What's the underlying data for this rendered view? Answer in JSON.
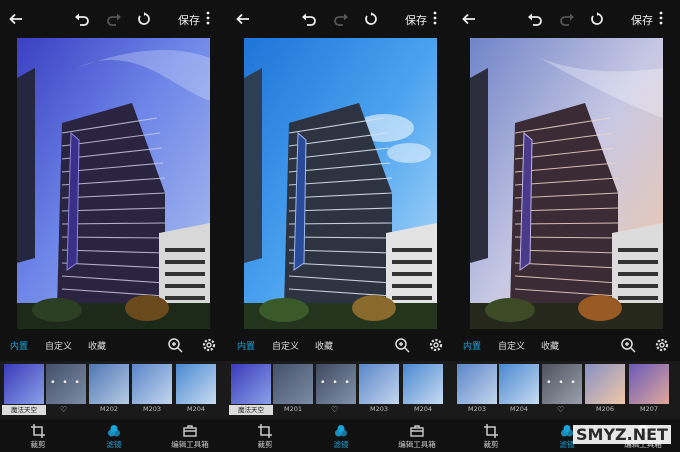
{
  "toolbar": {
    "save_label": "保存"
  },
  "categories": {
    "builtin": "内置",
    "custom": "自定义",
    "favorites": "收藏"
  },
  "bottom_nav": {
    "crop": "裁剪",
    "filters": "滤镜",
    "edit_tools": "编辑工具箱"
  },
  "panels": [
    {
      "thumbs": [
        "魔法天空",
        "M201",
        "M202",
        "M203",
        "M204"
      ],
      "selected": 0,
      "dots_on": 1,
      "heart_on": 1
    },
    {
      "thumbs": [
        "魔法天空",
        "M201",
        "M202",
        "M203",
        "M204"
      ],
      "selected": 2,
      "dots_on": 2,
      "heart_on": 2
    },
    {
      "thumbs": [
        "M203",
        "M204",
        "M205",
        "M206",
        "M207"
      ],
      "selected": 2,
      "dots_on": 2,
      "heart_on": 2
    }
  ],
  "watermark": "SMYZ.NET",
  "colors": {
    "accent": "#1aa3d9",
    "background": "#111111"
  }
}
